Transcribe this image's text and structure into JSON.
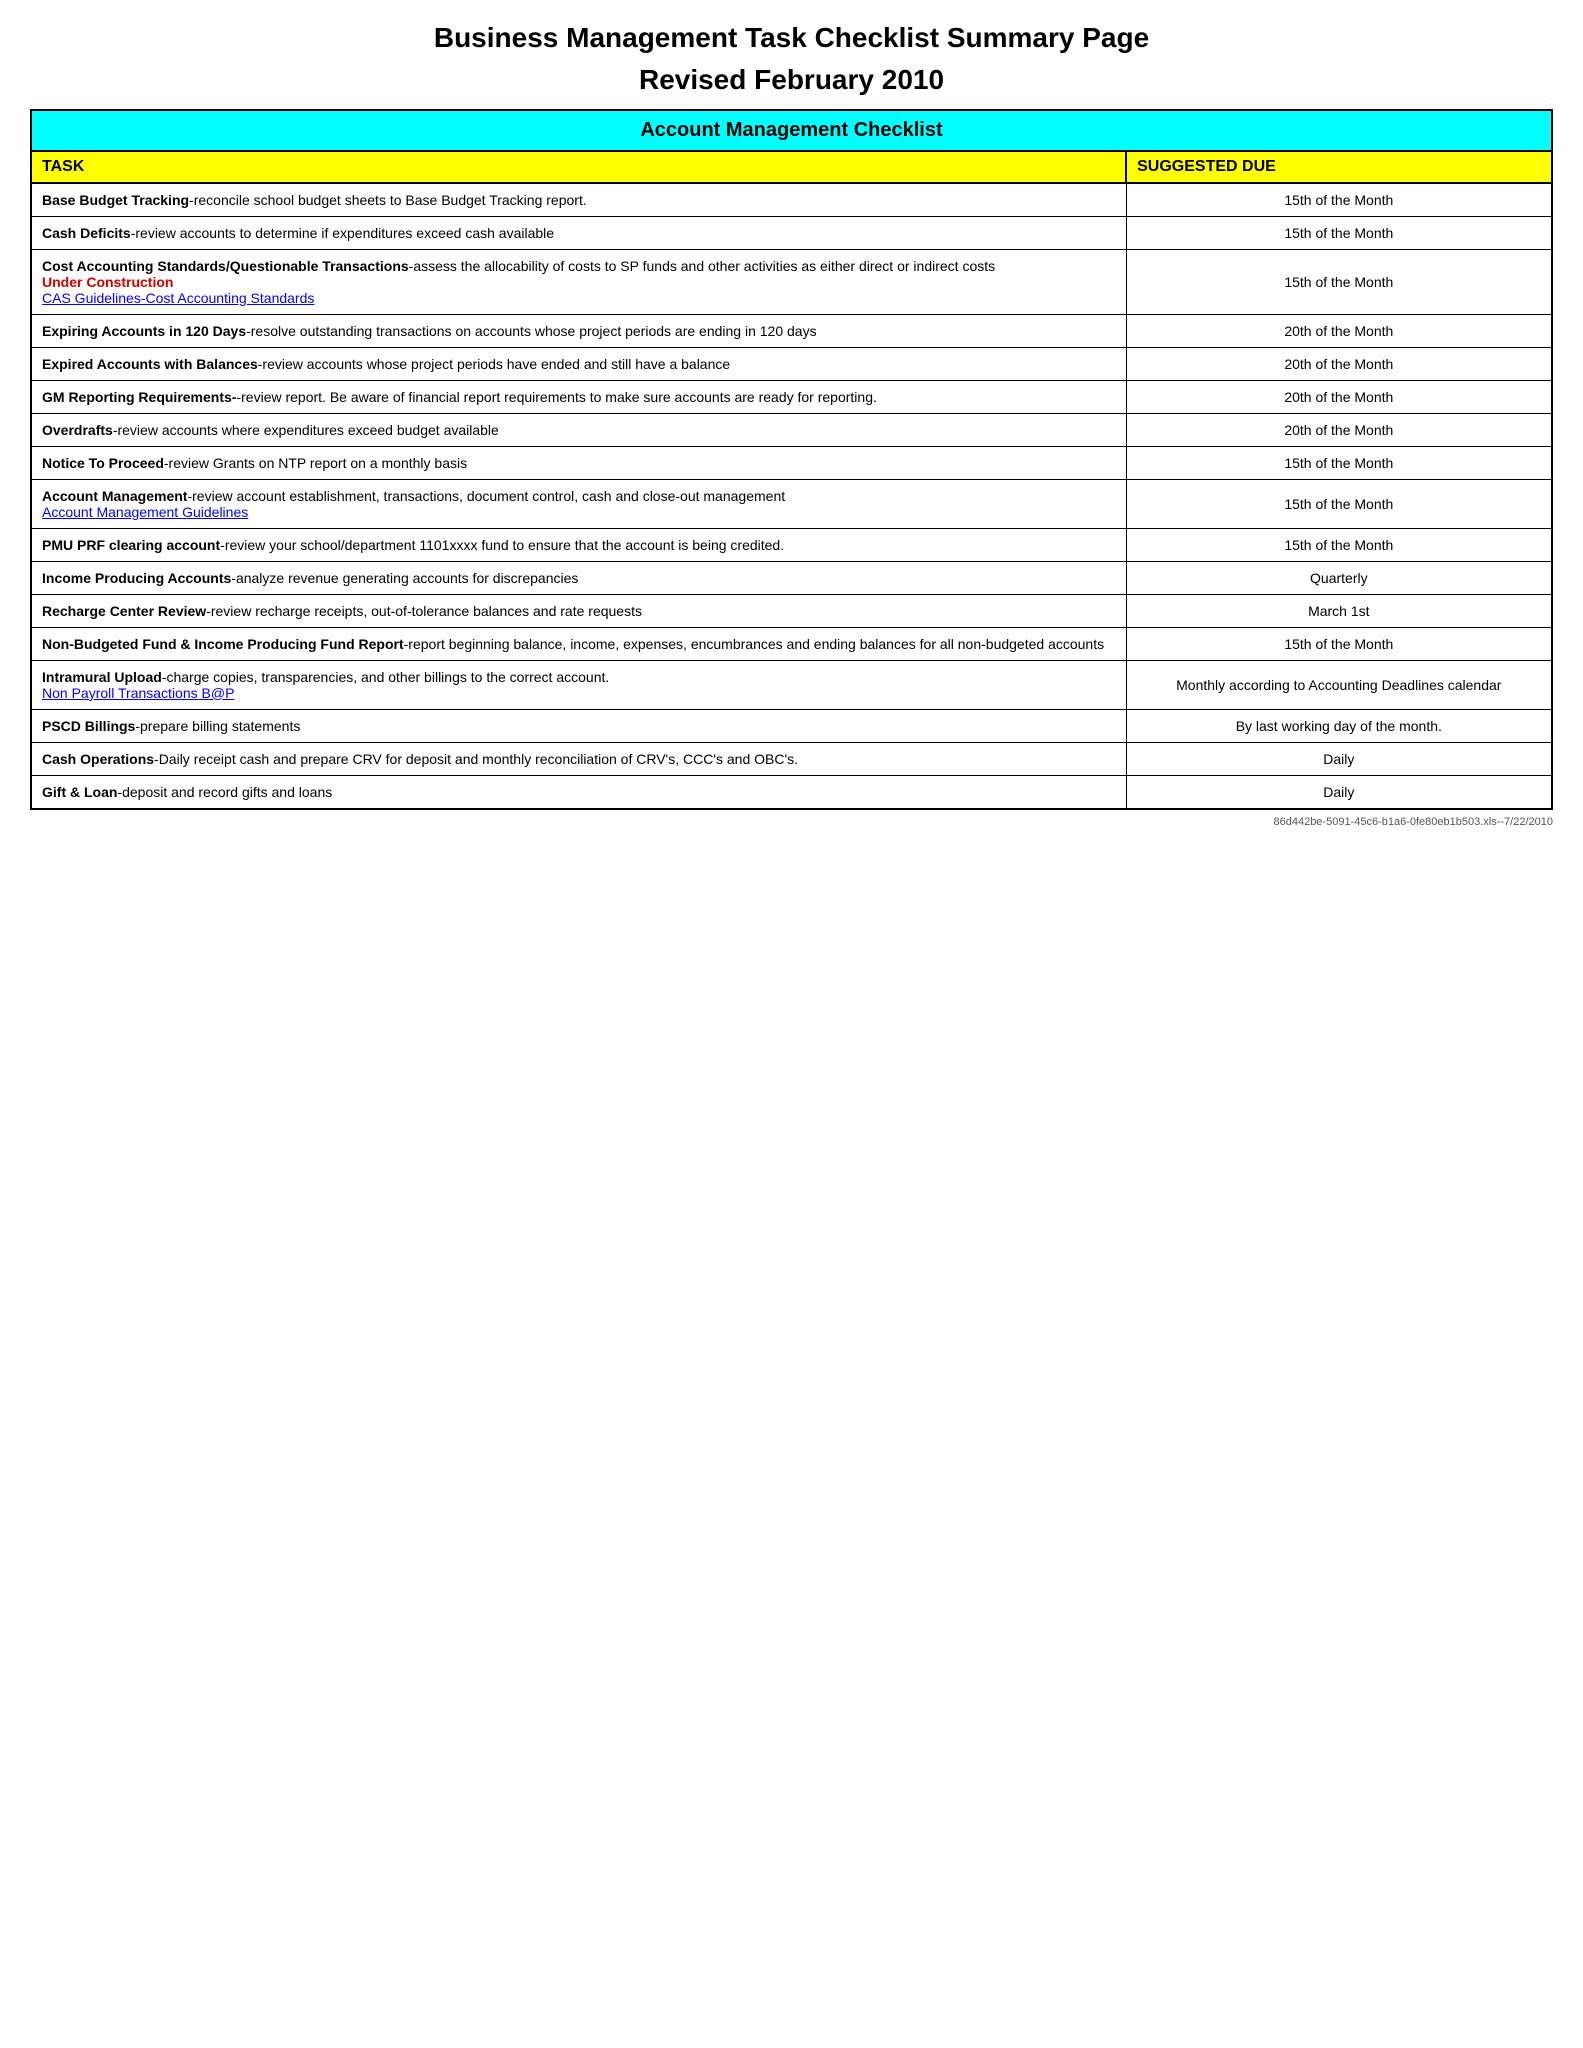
{
  "title_line1": "Business Management Task Checklist Summary Page",
  "title_line2": "Revised February 2010",
  "header": "Account Management Checklist",
  "col_task": "TASK",
  "col_due": "SUGGESTED DUE",
  "rows": [
    {
      "task_bold": "Base Budget Tracking",
      "task_normal": "-reconcile school budget sheets to Base Budget Tracking report.",
      "due": "15th of the Month",
      "link": null,
      "link_text": null,
      "under_construction": false,
      "under_construction_text": null
    },
    {
      "task_bold": "Cash Deficits",
      "task_normal": "-review accounts to determine if expenditures exceed cash available",
      "due": "15th of the Month",
      "link": null,
      "link_text": null,
      "under_construction": false,
      "under_construction_text": null
    },
    {
      "task_bold": "Cost Accounting Standards/Questionable Transactions",
      "task_normal": "-assess the allocability of costs to SP funds and other activities as either direct or indirect costs",
      "due": "15th of the Month",
      "link": "#",
      "link_text": "CAS Guidelines-Cost Accounting Standards",
      "under_construction": true,
      "under_construction_text": "Under Construction"
    },
    {
      "task_bold": "Expiring Accounts in 120 Days",
      "task_normal": "-resolve outstanding transactions on accounts whose project periods are ending in 120 days",
      "due": "20th of the Month",
      "link": null,
      "link_text": null,
      "under_construction": false,
      "under_construction_text": null
    },
    {
      "task_bold": "Expired Accounts with Balances",
      "task_normal": "-review accounts whose project periods have ended and still have a balance",
      "due": "20th of the Month",
      "link": null,
      "link_text": null,
      "under_construction": false,
      "under_construction_text": null
    },
    {
      "task_bold": "GM Reporting Requirements-",
      "task_normal": "-review report.  Be aware of financial report requirements to make sure accounts are ready for reporting.",
      "due": "20th of the Month",
      "link": null,
      "link_text": null,
      "under_construction": false,
      "under_construction_text": null
    },
    {
      "task_bold": "Overdrafts",
      "task_normal": "-review accounts where expenditures exceed budget available",
      "due": "20th of the Month",
      "link": null,
      "link_text": null,
      "under_construction": false,
      "under_construction_text": null
    },
    {
      "task_bold": "Notice To Proceed",
      "task_normal": "-review Grants on NTP report on a monthly basis",
      "due": "15th of the Month",
      "link": null,
      "link_text": null,
      "under_construction": false,
      "under_construction_text": null
    },
    {
      "task_bold": "Account Management",
      "task_normal": "-review account establishment, transactions, document control, cash and close-out management",
      "due": "15th of the Month",
      "link": "#",
      "link_text": "Account Management Guidelines",
      "under_construction": false,
      "under_construction_text": null
    },
    {
      "task_bold": "PMU PRF clearing account",
      "task_normal": "-review your school/department 1101xxxx fund to ensure that the account is being credited.",
      "due": "15th of the Month",
      "link": null,
      "link_text": null,
      "under_construction": false,
      "under_construction_text": null
    },
    {
      "task_bold": "Income Producing Accounts",
      "task_normal": "-analyze revenue generating accounts for discrepancies",
      "due": "Quarterly",
      "link": null,
      "link_text": null,
      "under_construction": false,
      "under_construction_text": null
    },
    {
      "task_bold": "Recharge Center Review",
      "task_normal": "-review recharge receipts, out-of-tolerance balances and rate requests",
      "due": "March 1st",
      "link": null,
      "link_text": null,
      "under_construction": false,
      "under_construction_text": null
    },
    {
      "task_bold": "Non-Budgeted Fund & Income Producing Fund Report",
      "task_normal": "-report beginning balance, income, expenses, encumbrances and ending balances for all non-budgeted accounts",
      "due": "15th of the Month",
      "link": null,
      "link_text": null,
      "under_construction": false,
      "under_construction_text": null
    },
    {
      "task_bold": "Intramural Upload",
      "task_normal": "-charge copies, transparencies, and other billings to the correct account.",
      "due": "Monthly according to\nAccounting Deadlines calendar",
      "link": "#",
      "link_text": "Non Payroll Transactions B@P",
      "under_construction": false,
      "under_construction_text": null
    },
    {
      "task_bold": "PSCD Billings",
      "task_normal": "-prepare billing statements",
      "due": "By last working day of the month.",
      "link": null,
      "link_text": null,
      "under_construction": false,
      "under_construction_text": null
    },
    {
      "task_bold": "Cash Operations",
      "task_normal": "-Daily receipt cash and prepare CRV for deposit and monthly reconciliation of CRV's, CCC's  and OBC's.",
      "due": "Daily",
      "link": null,
      "link_text": null,
      "under_construction": false,
      "under_construction_text": null
    },
    {
      "task_bold": "Gift & Loan",
      "task_normal": "-deposit and record gifts and loans",
      "due": "Daily",
      "link": null,
      "link_text": null,
      "under_construction": false,
      "under_construction_text": null
    }
  ],
  "footer": "86d442be-5091-45c6-b1a6-0fe80eb1b503.xls--7/22/2010"
}
